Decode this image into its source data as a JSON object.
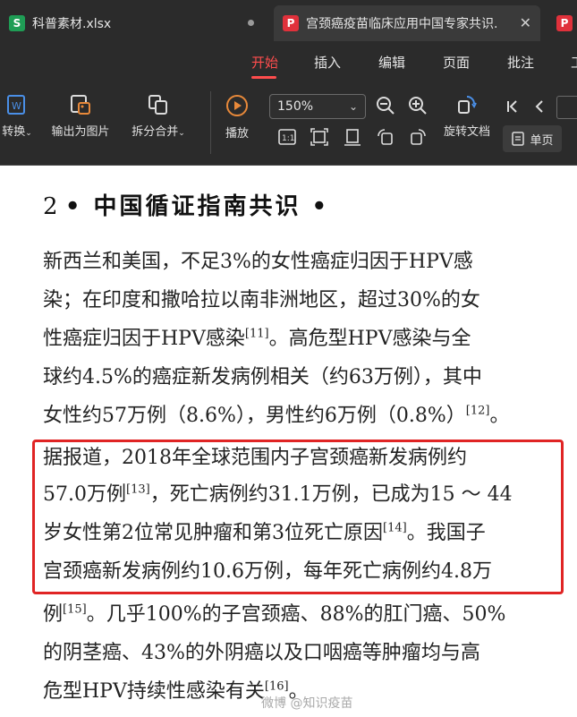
{
  "tabs": [
    {
      "icon": "S",
      "label": "科普素材.xlsx"
    },
    {
      "icon": "P",
      "label": "宫颈癌疫苗临床应用中国专家共识."
    }
  ],
  "menu": [
    "开始",
    "插入",
    "编辑",
    "页面",
    "批注",
    "工"
  ],
  "toolbar": {
    "convert": "转换",
    "export_image": "输出为图片",
    "split_merge": "拆分合并",
    "play": "播放",
    "zoom": "150%",
    "rotate": "旋转文档",
    "single_page": "单页"
  },
  "document": {
    "heading_number": "2",
    "heading_text": "• 中国循证指南共识 •",
    "lines": [
      {
        "t": "新西兰和美国，不足3%的女性癌症归因于HPV感"
      },
      {
        "t": "染；在印度和撒哈拉以南非洲地区，超过30%的女"
      },
      {
        "t": "性癌症归因于HPV感染",
        "ref": "[11]",
        "t2": "。高危型HPV感染与全"
      },
      {
        "t": "球约4.5%的癌症新发病例相关（约63万例），其中"
      },
      {
        "t": "女性约57万例（8.6%），男性约6万例（0.8%）",
        "ref": "[12]",
        "t2": "。"
      },
      {
        "t": "据报道，2018年全球范围内子宫颈癌新发病例约"
      },
      {
        "t": "57.0万例",
        "ref": "[13]",
        "t2": "，死亡病例约31.1万例，已成为15 ～ 44"
      },
      {
        "t": "岁女性第2位常见肿瘤和第3位死亡原因",
        "ref": "[14]",
        "t2": "。我国子"
      },
      {
        "t": "宫颈癌新发病例约10.6万例，每年死亡病例约4.8万"
      },
      {
        "t": "例",
        "ref": "[15]",
        "t2": "。几乎100%的子宫颈癌、88%的肛门癌、50%"
      },
      {
        "t": "的阴茎癌、43%的外阴癌以及口咽癌等肿瘤均与高"
      },
      {
        "t": "危型HPV持续性感染有关",
        "ref": "[16]",
        "t2": "。"
      }
    ]
  },
  "watermark": "微博 @知识疫苗",
  "colors": {
    "accent": "#ff4d4d",
    "highlight_box": "#e02424",
    "dark_ui": "#2b2b2b"
  }
}
